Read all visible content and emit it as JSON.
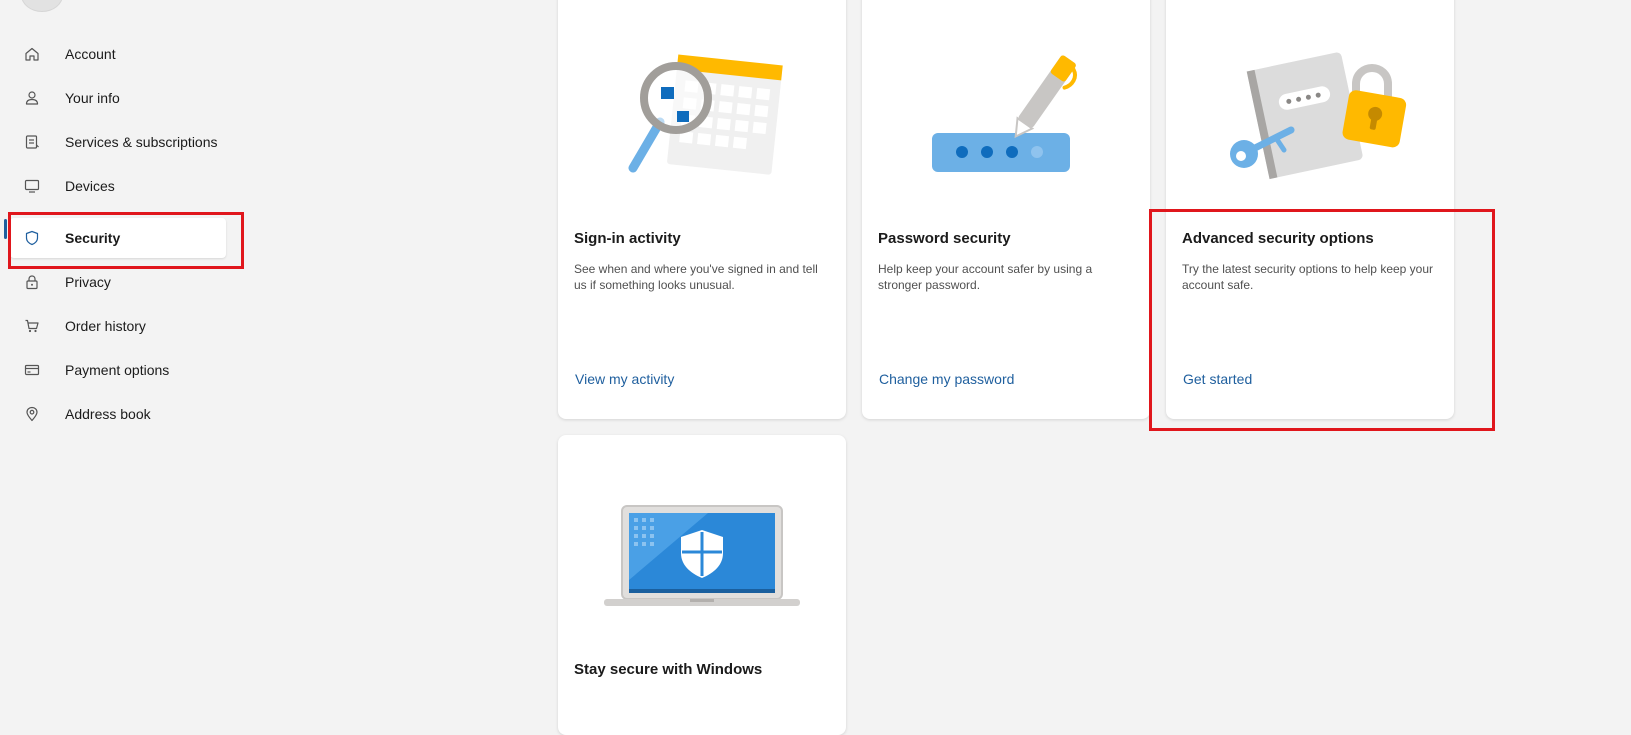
{
  "sidebar": {
    "items": [
      {
        "label": "Account",
        "icon": "home-icon"
      },
      {
        "label": "Your info",
        "icon": "person-icon"
      },
      {
        "label": "Services & subscriptions",
        "icon": "subscriptions-icon"
      },
      {
        "label": "Devices",
        "icon": "monitor-icon"
      },
      {
        "label": "Security",
        "icon": "shield-icon",
        "active": true
      },
      {
        "label": "Privacy",
        "icon": "lock-icon"
      },
      {
        "label": "Order history",
        "icon": "cart-icon"
      },
      {
        "label": "Payment options",
        "icon": "credit-card-icon"
      },
      {
        "label": "Address book",
        "icon": "location-pin-icon"
      }
    ]
  },
  "cards": [
    {
      "title": "Sign-in activity",
      "description": "See when and where you've signed in and tell us if something looks unusual.",
      "link": "View my activity"
    },
    {
      "title": "Password security",
      "description": "Help keep your account safer by using a stronger password.",
      "link": "Change my password"
    },
    {
      "title": "Advanced security options",
      "description": "Try the latest security options to help keep your account safe.",
      "link": "Get started"
    },
    {
      "title": "Stay secure with Windows"
    }
  ],
  "colors": {
    "accent": "#1f5f9e",
    "highlight": "#e0161c",
    "background": "#f3f3f3"
  }
}
